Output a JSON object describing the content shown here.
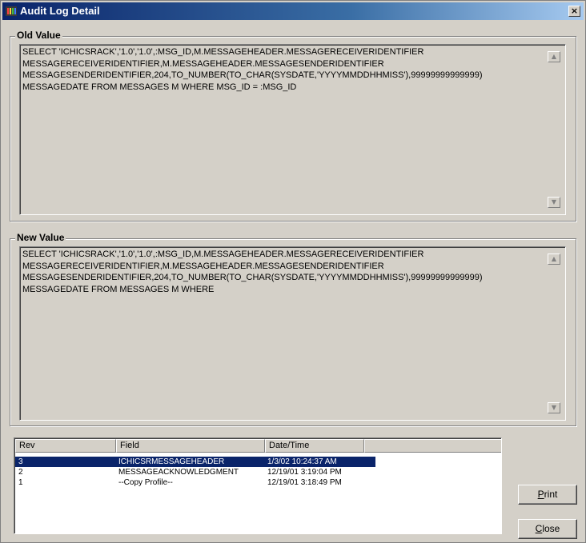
{
  "window": {
    "title": "Audit Log Detail",
    "close_glyph": "×"
  },
  "old_value": {
    "label": "Old Value",
    "lines": [
      "SELECT 'ICHICSRACK','1.0','1.0',:MSG_ID,M.MESSAGEHEADER.MESSAGERECEIVERIDENTIFIER",
      "MESSAGERECEIVERIDENTIFIER,M.MESSAGEHEADER.MESSAGESENDERIDENTIFIER",
      "MESSAGESENDERIDENTIFIER,204,TO_NUMBER(TO_CHAR(SYSDATE,'YYYYMMDDHHMISS'),99999999999999)",
      "MESSAGEDATE FROM MESSAGES M WHERE MSG_ID = :MSG_ID"
    ]
  },
  "new_value": {
    "label": "New Value",
    "lines": [
      "SELECT 'ICHICSRACK','1.0','1.0',:MSG_ID,M.MESSAGEHEADER.MESSAGERECEIVERIDENTIFIER",
      "MESSAGERECEIVERIDENTIFIER,M.MESSAGEHEADER.MESSAGESENDERIDENTIFIER",
      "MESSAGESENDERIDENTIFIER,204,TO_NUMBER(TO_CHAR(SYSDATE,'YYYYMMDDHHMISS'),99999999999999)",
      "MESSAGEDATE FROM MESSAGES M WHERE"
    ]
  },
  "revisions": {
    "columns": [
      "Rev",
      "Field",
      "Date/Time"
    ],
    "rows": [
      {
        "rev": "3",
        "field": "ICHICSRMESSAGEHEADER",
        "datetime": "1/3/02 10:24:37 AM",
        "selected": true
      },
      {
        "rev": "2",
        "field": "MESSAGEACKNOWLEDGMENT",
        "datetime": "12/19/01 3:19:04 PM",
        "selected": false
      },
      {
        "rev": "1",
        "field": "--Copy Profile--",
        "datetime": "12/19/01 3:18:49 PM",
        "selected": false
      }
    ]
  },
  "buttons": {
    "print": {
      "mnemonic": "P",
      "rest": "rint"
    },
    "close": {
      "mnemonic": "C",
      "rest": "lose"
    }
  },
  "icons": {
    "app": "audit-log-icon",
    "scroll_up": "▲",
    "scroll_down": "▼"
  },
  "colors": {
    "titlebar": "#0a246a",
    "selection": "#0a246a",
    "face": "#d4d0c8"
  }
}
